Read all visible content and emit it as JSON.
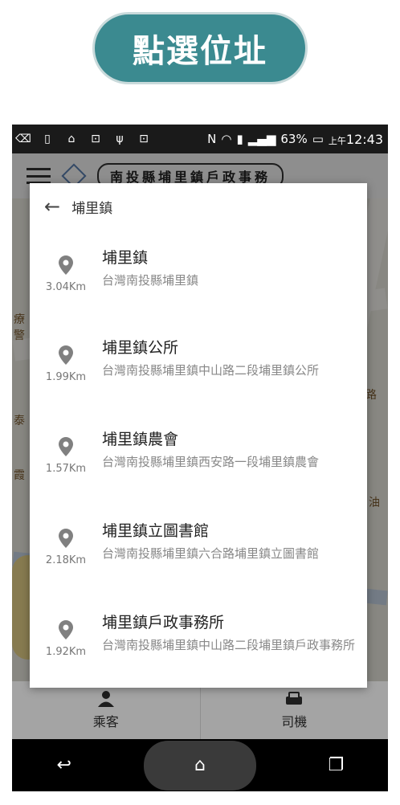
{
  "banner": {
    "title": "點選位址"
  },
  "statusbar": {
    "battery": "63%",
    "clock_prefix": "上午",
    "clock": "12:43"
  },
  "appbar": {
    "office_label": "南投縣埔里鎮戶政事務"
  },
  "map_labels": [
    "療",
    "警",
    "泰",
    "霞",
    "路",
    "油"
  ],
  "dialog": {
    "title": "埔里鎮",
    "results": [
      {
        "name": "埔里鎮",
        "address": "台灣南投縣埔里鎮",
        "distance": "3.04Km"
      },
      {
        "name": "埔里鎮公所",
        "address": "台灣南投縣埔里鎮中山路二段埔里鎮公所",
        "distance": "1.99Km"
      },
      {
        "name": "埔里鎮農會",
        "address": "台灣南投縣埔里鎮西安路一段埔里鎮農會",
        "distance": "1.57Km"
      },
      {
        "name": "埔里鎮立圖書館",
        "address": "台灣南投縣埔里鎮六合路埔里鎮立圖書館",
        "distance": "2.18Km"
      },
      {
        "name": "埔里鎮戶政事務所",
        "address": "台灣南投縣埔里鎮中山路二段埔里鎮戶政事務所",
        "distance": "1.92Km"
      }
    ]
  },
  "tabs": {
    "passenger": "乘客",
    "driver": "司機"
  },
  "colors": {
    "banner": "#3b8a90",
    "pin": "#808080"
  }
}
